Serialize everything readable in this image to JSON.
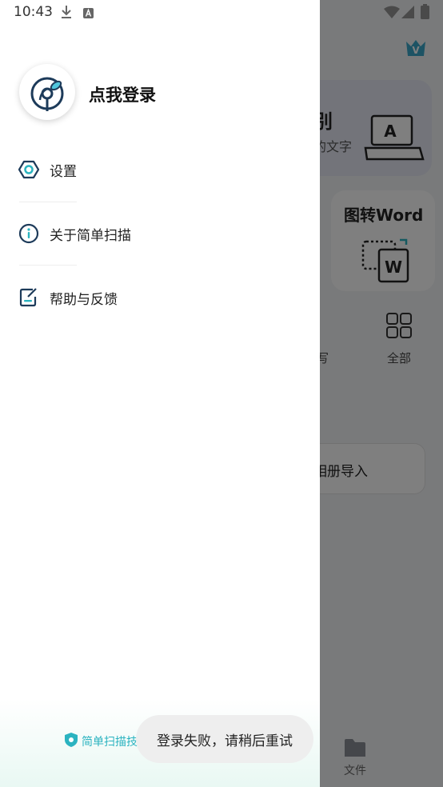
{
  "status_bar": {
    "time": "10:43"
  },
  "drawer": {
    "login_label": "点我登录",
    "menu": [
      {
        "label": "设置",
        "icon": "settings-icon"
      },
      {
        "label": "关于简单扫描",
        "icon": "info-icon"
      },
      {
        "label": "帮助与反馈",
        "icon": "feedback-icon"
      }
    ],
    "footer_label": "简单扫描技术"
  },
  "background": {
    "card1_title": "别",
    "card1_sub": "的文字",
    "card2_title": "图转Word",
    "tool_partial": "写",
    "tool_all": "全部",
    "import_label": "相册导入",
    "nav_files": "文件"
  },
  "toast": {
    "message": "登录失败，请稍后重试"
  },
  "colors": {
    "accent": "#2bb3c0",
    "icon_dark": "#1d3b5a",
    "drawer_bg": "#ffffff",
    "scrim": "rgba(0,0,0,0.5)"
  }
}
